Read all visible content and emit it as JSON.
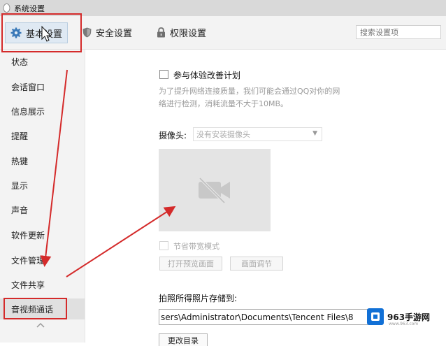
{
  "window": {
    "title": "系统设置"
  },
  "tabs": {
    "basic": "基本设置",
    "security": "安全设置",
    "permission": "权限设置"
  },
  "search": {
    "placeholder": "搜索设置项"
  },
  "sidebar": {
    "items": [
      {
        "label": "状态"
      },
      {
        "label": "会话窗口"
      },
      {
        "label": "信息展示"
      },
      {
        "label": "提醒"
      },
      {
        "label": "热键"
      },
      {
        "label": "显示"
      },
      {
        "label": "声音"
      },
      {
        "label": "软件更新"
      },
      {
        "label": "文件管理"
      },
      {
        "label": "文件共享"
      },
      {
        "label": "音视频通话"
      }
    ]
  },
  "main": {
    "experience_plan_label": "参与体验改善计划",
    "experience_plan_desc": "为了提升网络连接质量，我们可能会通过QQ对你的网络进行检测，消耗流量不大于10MB。",
    "camera_label": "摄像头:",
    "camera_value": "没有安装摄像头",
    "bandwidth_label": "节省带宽模式",
    "open_preview_button": "打开预览画面",
    "adjust_button": "画面调节",
    "save_path_label": "拍照所得照片存储到:",
    "save_path_value": "sers\\Administrator\\Documents\\Tencent Files\\8",
    "change_dir_button": "更改目录"
  },
  "watermark": {
    "brand": "963手游网",
    "url": "www.963.com"
  },
  "colors": {
    "highlight": "#d42a2a",
    "sidebar_bg": "#f3f3f3",
    "accent_blue": "#1170d6"
  }
}
